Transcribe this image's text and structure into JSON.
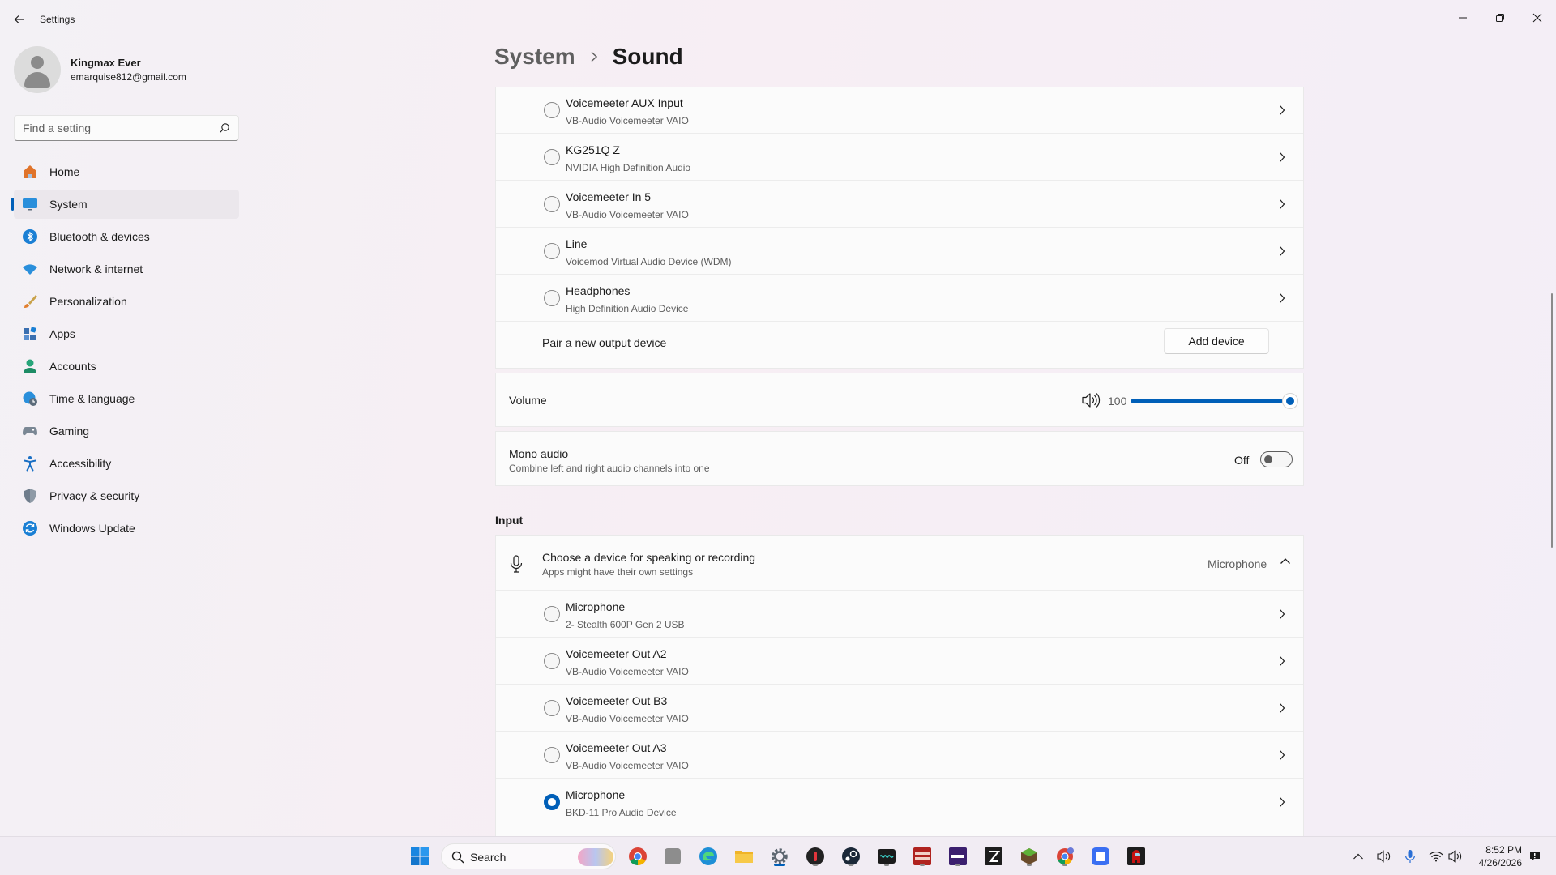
{
  "window": {
    "title": "Settings"
  },
  "profile": {
    "name": "Kingmax Ever",
    "email": "emarquise812@gmail.com"
  },
  "search": {
    "placeholder": "Find a setting"
  },
  "nav": [
    {
      "label": "Home",
      "icon": "home-icon",
      "active": false
    },
    {
      "label": "System",
      "icon": "system-icon",
      "active": true
    },
    {
      "label": "Bluetooth & devices",
      "icon": "bluetooth-icon",
      "active": false
    },
    {
      "label": "Network & internet",
      "icon": "wifi-icon",
      "active": false
    },
    {
      "label": "Personalization",
      "icon": "brush-icon",
      "active": false
    },
    {
      "label": "Apps",
      "icon": "apps-icon",
      "active": false
    },
    {
      "label": "Accounts",
      "icon": "accounts-icon",
      "active": false
    },
    {
      "label": "Time & language",
      "icon": "globe-clock-icon",
      "active": false
    },
    {
      "label": "Gaming",
      "icon": "controller-icon",
      "active": false
    },
    {
      "label": "Accessibility",
      "icon": "accessibility-icon",
      "active": false
    },
    {
      "label": "Privacy & security",
      "icon": "shield-icon",
      "active": false
    },
    {
      "label": "Windows Update",
      "icon": "update-icon",
      "active": false
    }
  ],
  "breadcrumb": {
    "parent": "System",
    "current": "Sound"
  },
  "output": {
    "devices": [
      {
        "name": "Voicemeeter AUX Input",
        "sub": "VB-Audio Voicemeeter VAIO",
        "selected": false
      },
      {
        "name": "KG251Q Z",
        "sub": "NVIDIA High Definition Audio",
        "selected": false
      },
      {
        "name": "Voicemeeter In 5",
        "sub": "VB-Audio Voicemeeter VAIO",
        "selected": false
      },
      {
        "name": "Line",
        "sub": "Voicemod Virtual Audio Device (WDM)",
        "selected": false
      },
      {
        "name": "Headphones",
        "sub": "High Definition Audio Device",
        "selected": false
      }
    ],
    "pair_label": "Pair a new output device",
    "add_button": "Add device"
  },
  "volume": {
    "label": "Volume",
    "value": "100",
    "level": 1.0
  },
  "mono": {
    "title": "Mono audio",
    "sub": "Combine left and right audio channels into one",
    "state": "Off"
  },
  "input": {
    "section_label": "Input",
    "head_title": "Choose a device for speaking or recording",
    "head_sub": "Apps might have their own settings",
    "head_value": "Microphone",
    "devices": [
      {
        "name": "Microphone",
        "sub": "2- Stealth 600P Gen 2 USB",
        "selected": false
      },
      {
        "name": "Voicemeeter Out A2",
        "sub": "VB-Audio Voicemeeter VAIO",
        "selected": false
      },
      {
        "name": "Voicemeeter Out B3",
        "sub": "VB-Audio Voicemeeter VAIO",
        "selected": false
      },
      {
        "name": "Voicemeeter Out A3",
        "sub": "VB-Audio Voicemeeter VAIO",
        "selected": false
      },
      {
        "name": "Microphone",
        "sub": "BKD-11 Pro Audio Device",
        "selected": true
      }
    ]
  },
  "taskbar": {
    "search_label": "Search",
    "clock_time": "8:52 PM",
    "clock_date": "4/26/2026"
  },
  "colors": {
    "accent": "#005fb8",
    "background": "#f3eef5",
    "card": "#fbfbfb"
  }
}
